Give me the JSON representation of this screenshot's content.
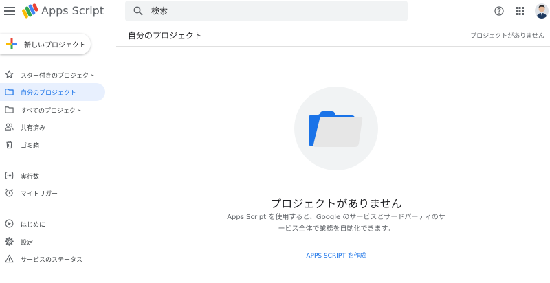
{
  "header": {
    "app_title": "Apps Script",
    "search_placeholder": "検索",
    "icons": [
      "menu-icon",
      "search-icon",
      "help-icon",
      "apps-icon",
      "avatar"
    ]
  },
  "sidebar": {
    "new_project_label": "新しいプロジェクト",
    "items": [
      {
        "label": "スター付きのプロジェクト",
        "icon": "star-icon",
        "active": false
      },
      {
        "label": "自分のプロジェクト",
        "icon": "folder-icon",
        "active": true
      },
      {
        "label": "すべてのプロジェクト",
        "icon": "folder-icon",
        "active": false
      },
      {
        "label": "共有済み",
        "icon": "people-icon",
        "active": false
      },
      {
        "label": "ゴミ箱",
        "icon": "trash-icon",
        "active": false
      },
      {
        "label": "実行数",
        "icon": "executions-icon",
        "active": false
      },
      {
        "label": "マイトリガー",
        "icon": "alarm-icon",
        "active": false
      },
      {
        "label": "はじめに",
        "icon": "play-circle-icon",
        "active": false
      },
      {
        "label": "設定",
        "icon": "gear-icon",
        "active": false
      },
      {
        "label": "サービスのステータス",
        "icon": "warning-icon",
        "active": false
      }
    ]
  },
  "main": {
    "title": "自分のプロジェクト",
    "status": "プロジェクトがありません",
    "empty_title": "プロジェクトがありません",
    "empty_desc_line1": "Apps Script を使用すると、Google のサービスとサードパーティのサ",
    "empty_desc_line2": "ービス全体で業務を自動化できます。",
    "create_link": "APPS SCRIPT を作成"
  },
  "colors": {
    "accent": "#1a73e8",
    "active_bg": "#e8f0fe",
    "folder_blue": "#1a73e8",
    "illustration_bg": "#f1f3f4"
  }
}
